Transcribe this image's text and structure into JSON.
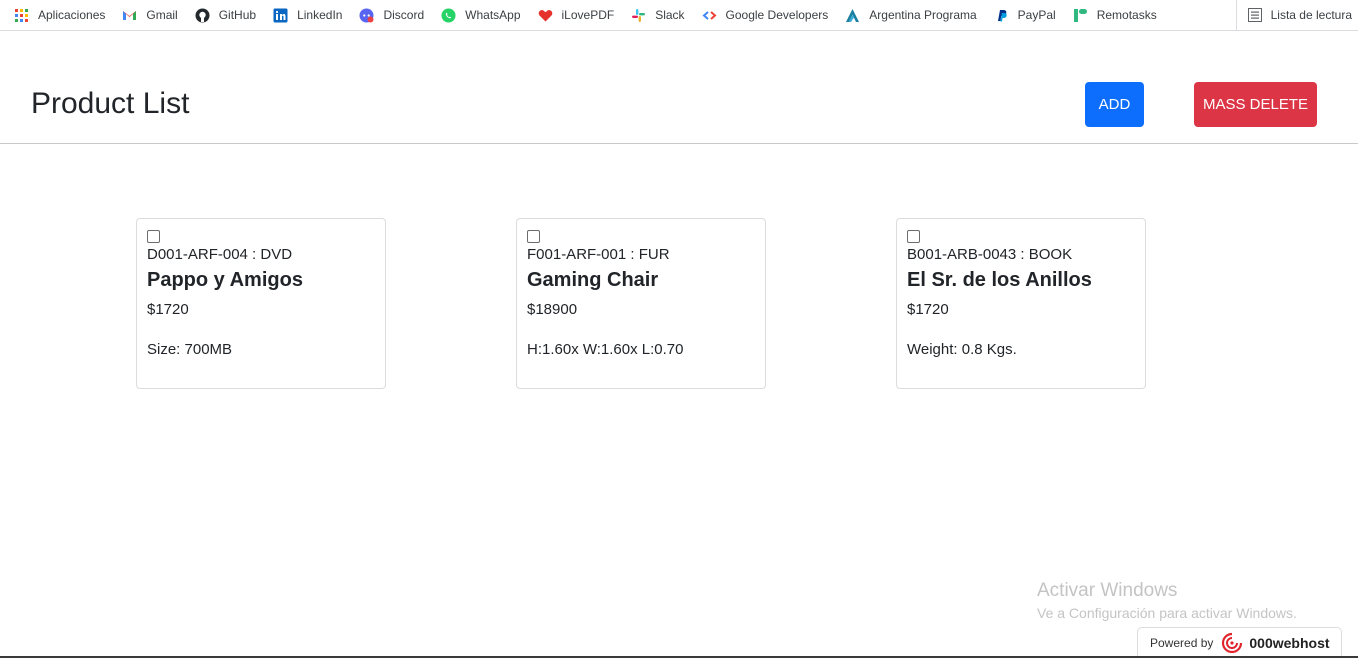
{
  "bookmarks": [
    {
      "label": "Aplicaciones",
      "icon": "apps-grid-icon"
    },
    {
      "label": "Gmail",
      "icon": "gmail-icon"
    },
    {
      "label": "GitHub",
      "icon": "github-icon"
    },
    {
      "label": "LinkedIn",
      "icon": "linkedin-icon"
    },
    {
      "label": "Discord",
      "icon": "discord-icon"
    },
    {
      "label": "WhatsApp",
      "icon": "whatsapp-icon"
    },
    {
      "label": "iLovePDF",
      "icon": "ilovepdf-icon"
    },
    {
      "label": "Slack",
      "icon": "slack-icon"
    },
    {
      "label": "Google Developers",
      "icon": "google-developers-icon"
    },
    {
      "label": "Argentina Programa",
      "icon": "argentina-programa-icon"
    },
    {
      "label": "PayPal",
      "icon": "paypal-icon"
    },
    {
      "label": "Remotasks",
      "icon": "remotasks-icon"
    }
  ],
  "reading_list": {
    "label": "Lista de lectura",
    "icon": "reading-list-icon"
  },
  "header": {
    "title": "Product List",
    "add_label": "ADD",
    "mass_delete_label": "MASS DELETE"
  },
  "products": [
    {
      "sku_type": "D001-ARF-004 : DVD",
      "name": "Pappo y Amigos",
      "price": "$1720",
      "attribute": "Size: 700MB"
    },
    {
      "sku_type": "F001-ARF-001 : FUR",
      "name": "Gaming Chair",
      "price": "$18900",
      "attribute": "H:1.60x W:1.60x L:0.70"
    },
    {
      "sku_type": "B001-ARB-0043 : BOOK",
      "name": "El Sr. de los Anillos",
      "price": "$1720",
      "attribute": "Weight: 0.8 Kgs."
    }
  ],
  "watermark": {
    "title": "Activar Windows",
    "subtitle": "Ve a Configuración para activar Windows."
  },
  "powered_by": {
    "label": "Powered by",
    "brand": "000webhost"
  },
  "colors": {
    "add": "#0d6efd",
    "mass_delete": "#dc3545"
  }
}
